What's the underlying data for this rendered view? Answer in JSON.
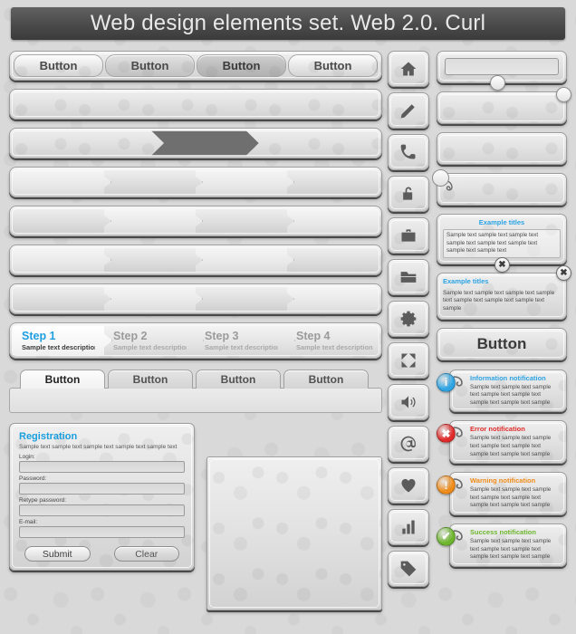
{
  "header": {
    "title": "Web design elements set. Web 2.0. Curl"
  },
  "buttons_row_top": [
    {
      "label": "Button",
      "style": "light"
    },
    {
      "label": "Button",
      "style": "shade"
    },
    {
      "label": "Button",
      "style": "dark"
    },
    {
      "label": "Button",
      "style": "light"
    }
  ],
  "progress": {
    "fill_percent": 29,
    "offset_percent": 38
  },
  "steps": [
    {
      "title": "Step 1",
      "desc": "Sample text description",
      "active": true
    },
    {
      "title": "Step 2",
      "desc": "Sample text description",
      "active": false
    },
    {
      "title": "Step 3",
      "desc": "Sample text description",
      "active": false
    },
    {
      "title": "Step 4",
      "desc": "Sample text description",
      "active": false
    }
  ],
  "tabs": [
    {
      "label": "Button",
      "active": true
    },
    {
      "label": "Button",
      "active": false
    },
    {
      "label": "Button",
      "active": false
    },
    {
      "label": "Button",
      "active": false
    }
  ],
  "registration": {
    "title": "Registration",
    "subtitle": "Sample text sample text  sample text sample text sample text",
    "fields": [
      {
        "label": "Login:",
        "value": "",
        "placeholder": ""
      },
      {
        "label": "Password:",
        "value": "",
        "placeholder": ""
      },
      {
        "label": "Retype password:",
        "value": "",
        "placeholder": ""
      },
      {
        "label": "E-mail:",
        "value": "",
        "placeholder": ""
      }
    ],
    "submit_label": "Submit",
    "clear_label": "Clear"
  },
  "icons": [
    {
      "name": "home-icon"
    },
    {
      "name": "pencil-icon"
    },
    {
      "name": "phone-icon"
    },
    {
      "name": "lock-icon"
    },
    {
      "name": "briefcase-icon"
    },
    {
      "name": "folder-icon"
    },
    {
      "name": "gear-icon"
    },
    {
      "name": "fullscreen-icon"
    },
    {
      "name": "speaker-icon"
    },
    {
      "name": "at-email-icon"
    },
    {
      "name": "heart-icon"
    },
    {
      "name": "bar-chart-icon"
    },
    {
      "name": "tag-icon"
    }
  ],
  "right_column": {
    "search_field_value": "",
    "tooltip_top": {
      "title": "Example titles",
      "body": "Sample text sample text  sample text sample text sample text sample text sample text sample text",
      "close_label": "✖"
    },
    "tooltip_second": {
      "title": "Example titles",
      "body": "Sample text sample text  sample text sample text sample text sample text sample text sample",
      "close_label": "✖"
    },
    "big_button_label": "Button"
  },
  "notifications": [
    {
      "kind": "information",
      "title": "Information notification",
      "body": "Sample text sample text  sample text sample text sample text sample text sample text sample",
      "color": "#2ea4e3",
      "glyph": "i"
    },
    {
      "kind": "error",
      "title": "Error notification",
      "body": "Sample text sample text  sample text sample text sample text sample text sample text sample",
      "color": "#e02b2b",
      "glyph": "✖"
    },
    {
      "kind": "warning",
      "title": "Warning notification",
      "body": "Sample text sample text  sample text sample text sample text sample text sample text sample",
      "color": "#ef8b18",
      "glyph": "!"
    },
    {
      "kind": "success",
      "title": "Success notification",
      "body": "Sample text sample text  sample text sample text sample text sample text sample text sample",
      "color": "#6cb52d",
      "glyph": "✔"
    }
  ],
  "palette": {
    "header_bg": "#4a4a4a",
    "accent_blue": "#199ede",
    "panel_bg": "#e3e3e3",
    "page_bg": "#d9d9d9"
  }
}
